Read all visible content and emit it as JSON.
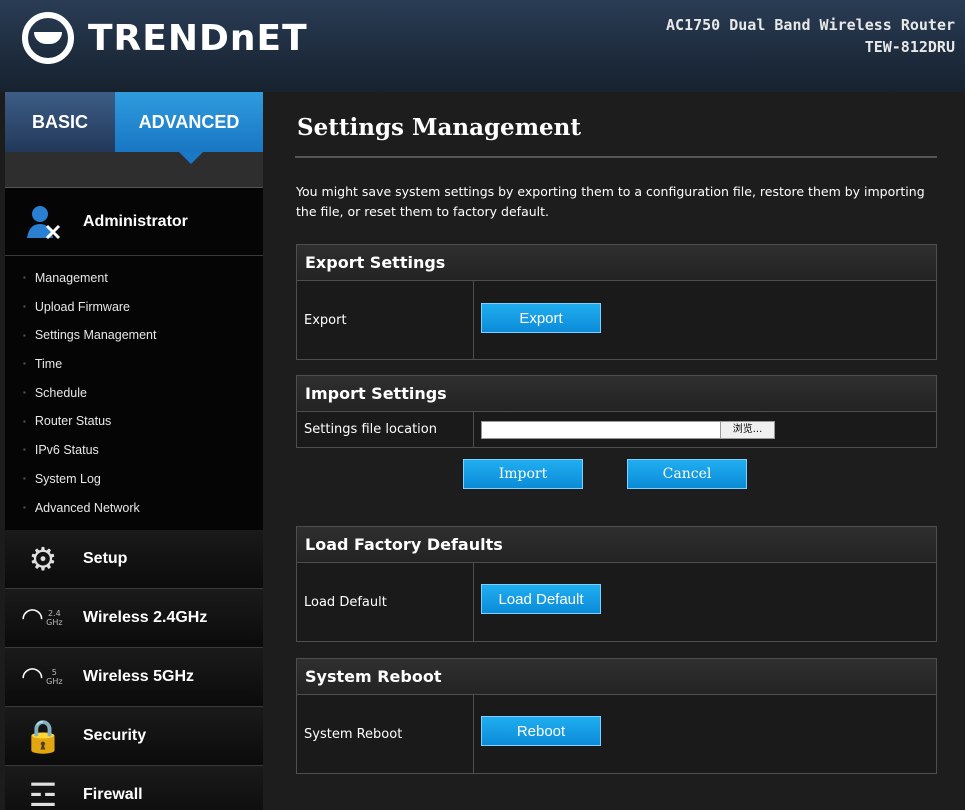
{
  "header": {
    "logo_text": "TRENDnET",
    "product_name": "AC1750 Dual Band Wireless Router",
    "model": "TEW-812DRU"
  },
  "sidebar": {
    "tabs": [
      {
        "label": "BASIC",
        "active": false
      },
      {
        "label": "ADVANCED",
        "active": true
      }
    ],
    "sections": [
      {
        "label": "Administrator",
        "icon": "administrator-icon"
      },
      {
        "label": "Setup",
        "icon": "gears-icon"
      },
      {
        "label": "Wireless 2.4GHz",
        "icon": "wifi-icon",
        "badge": "2.4 GHz"
      },
      {
        "label": "Wireless 5GHz",
        "icon": "wifi-icon",
        "badge": "5 GHz"
      },
      {
        "label": "Security",
        "icon": "lock-key-icon"
      },
      {
        "label": "Firewall",
        "icon": "firewall-icon"
      }
    ],
    "admin_items": [
      "Management",
      "Upload Firmware",
      "Settings Management",
      "Time",
      "Schedule",
      "Router Status",
      "IPv6 Status",
      "System Log",
      "Advanced Network"
    ]
  },
  "main": {
    "title": "Settings Management",
    "intro": "You might save system settings by exporting them to a configuration file, restore them by importing the file, or reset them to factory default.",
    "export": {
      "heading": "Export Settings",
      "label": "Export",
      "button": "Export"
    },
    "import": {
      "heading": "Import Settings",
      "label": "Settings file location",
      "browse": "浏览...",
      "import_button": "Import",
      "cancel_button": "Cancel"
    },
    "factory": {
      "heading": "Load Factory Defaults",
      "label": "Load Default",
      "button": "Load Default"
    },
    "reboot": {
      "heading": "System Reboot",
      "label": "System Reboot",
      "button": "Reboot"
    }
  },
  "colors": {
    "accent": "#1a8fd8",
    "background": "#1d1d1d"
  }
}
